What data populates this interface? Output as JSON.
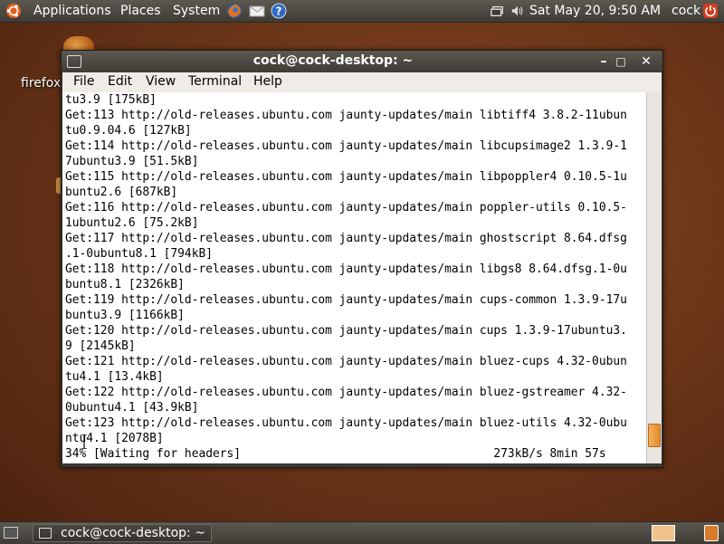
{
  "top_panel": {
    "applications": "Applications",
    "places": "Places",
    "system": "System",
    "clock": "Sat May 20,  9:50 AM",
    "user": "cock"
  },
  "desktop": {
    "firefox_label": "firefox"
  },
  "window": {
    "title": "cock@cock-desktop: ~",
    "menu": {
      "file": "File",
      "edit": "Edit",
      "view": "View",
      "terminal": "Terminal",
      "help": "Help"
    },
    "terminal_lines": [
      "tu3.9 [175kB]",
      "Get:113 http://old-releases.ubuntu.com jaunty-updates/main libtiff4 3.8.2-11ubun",
      "tu0.9.04.6 [127kB]",
      "Get:114 http://old-releases.ubuntu.com jaunty-updates/main libcupsimage2 1.3.9-1",
      "7ubuntu3.9 [51.5kB]",
      "Get:115 http://old-releases.ubuntu.com jaunty-updates/main libpoppler4 0.10.5-1u",
      "buntu2.6 [687kB]",
      "Get:116 http://old-releases.ubuntu.com jaunty-updates/main poppler-utils 0.10.5-",
      "1ubuntu2.6 [75.2kB]",
      "Get:117 http://old-releases.ubuntu.com jaunty-updates/main ghostscript 8.64.dfsg",
      ".1-0ubuntu8.1 [794kB]",
      "Get:118 http://old-releases.ubuntu.com jaunty-updates/main libgs8 8.64.dfsg.1-0u",
      "buntu8.1 [2326kB]",
      "Get:119 http://old-releases.ubuntu.com jaunty-updates/main cups-common 1.3.9-17u",
      "buntu3.9 [1166kB]",
      "Get:120 http://old-releases.ubuntu.com jaunty-updates/main cups 1.3.9-17ubuntu3.",
      "9 [2145kB]",
      "Get:121 http://old-releases.ubuntu.com jaunty-updates/main bluez-cups 4.32-0ubun",
      "tu4.1 [13.4kB]",
      "Get:122 http://old-releases.ubuntu.com jaunty-updates/main bluez-gstreamer 4.32-",
      "0ubuntu4.1 [43.9kB]",
      "Get:123 http://old-releases.ubuntu.com jaunty-updates/main bluez-utils 4.32-0ubu",
      "ntu4.1 [2078B]",
      "34% [Waiting for headers]                                    273kB/s 8min 57s"
    ]
  },
  "taskbar": {
    "task_label": "cock@cock-desktop: ~"
  },
  "icons": {
    "ubuntu": "ubuntu-logo-icon",
    "firefox": "firefox-icon",
    "mail": "mail-icon",
    "help": "help-icon",
    "network": "network-icon",
    "volume": "volume-icon",
    "shutdown": "shutdown-icon",
    "terminal": "terminal-icon"
  }
}
